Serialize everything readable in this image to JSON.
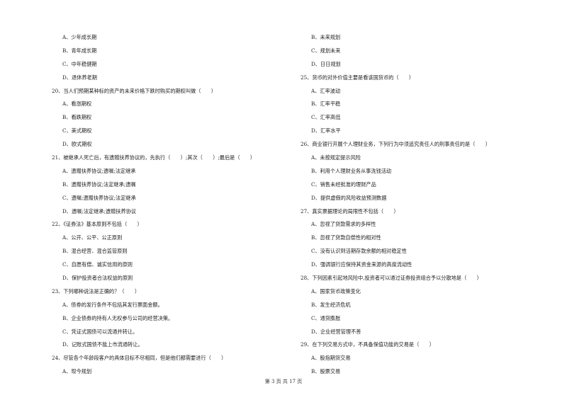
{
  "left_column": [
    {
      "type": "option",
      "text": "A、少年成长期"
    },
    {
      "type": "option",
      "text": "B、青年成长期"
    },
    {
      "type": "option",
      "text": "C、中年稳健期"
    },
    {
      "type": "option",
      "text": "D、退休养老期"
    },
    {
      "type": "question",
      "text": "20、当人们预期某种标的资产的未来价格下跌时购买的期权叫做（　　）"
    },
    {
      "type": "option",
      "text": "A、看涨期权"
    },
    {
      "type": "option",
      "text": "B、看跌期权"
    },
    {
      "type": "option",
      "text": "C、美式期权"
    },
    {
      "type": "option",
      "text": "D、欧式期权"
    },
    {
      "type": "question",
      "text": "21、被继承人死亡后，有遗赠扶养协议的，先执行（　　）;其次（　　）;最后是（　　）"
    },
    {
      "type": "option",
      "text": "A、遗赠扶养协议;遗嘱;法定继承"
    },
    {
      "type": "option",
      "text": "B、遗赠扶养协议;法定继承;遗嘱"
    },
    {
      "type": "option",
      "text": "C、遗嘱;遗赠扶养协议;法定继承"
    },
    {
      "type": "option",
      "text": "D、遗嘱;法定继承;遗赠扶养协议"
    },
    {
      "type": "question",
      "text": "22、《证券法》基本原则不包括（　　）"
    },
    {
      "type": "option",
      "text": "A、公开、公平、公正原则"
    },
    {
      "type": "option",
      "text": "B、混合经营、混合监管原则"
    },
    {
      "type": "option",
      "text": "C、自愿有偿、诚实信用的原则"
    },
    {
      "type": "option",
      "text": "D、保护投资者合法权益的原则"
    },
    {
      "type": "question",
      "text": "23、下列哪种说法是正确的？（　　）"
    },
    {
      "type": "option",
      "text": "A、债券的发行条件不包括其发行票面金额。"
    },
    {
      "type": "option",
      "text": "B、企业债券的持有人无权参与公司的经营决策。"
    },
    {
      "type": "option",
      "text": "C、凭证式国债可以流通并转让。"
    },
    {
      "type": "option",
      "text": "D、记账式国债不能上市流通转让。"
    },
    {
      "type": "question",
      "text": "24、尽管各个年龄段客户的具体目标不尽相同，但是他们都需要进行（　　）"
    },
    {
      "type": "option",
      "text": "A、现今规划"
    }
  ],
  "right_column": [
    {
      "type": "option",
      "text": "B、未来规划"
    },
    {
      "type": "option",
      "text": "C、规划未来"
    },
    {
      "type": "option",
      "text": "D、日日规划"
    },
    {
      "type": "question",
      "text": "25、货币的对外价值主要是看该国货币的（　　）"
    },
    {
      "type": "option",
      "text": "A、汇率波动"
    },
    {
      "type": "option",
      "text": "B、汇率平稳"
    },
    {
      "type": "option",
      "text": "C、汇率高低"
    },
    {
      "type": "option",
      "text": "D、汇率水平"
    },
    {
      "type": "question",
      "text": "26、商业银行开展个人理财业务，下列行为中须追究责任人的刑事责任的是（　　）"
    },
    {
      "type": "option",
      "text": "A、未按规定提示风险"
    },
    {
      "type": "option",
      "text": "B、利用个人理财业务从事洗钱活动"
    },
    {
      "type": "option",
      "text": "C、销售未经批准的理财产品"
    },
    {
      "type": "option",
      "text": "D、提供虚假的风险收益预测数据"
    },
    {
      "type": "question",
      "text": "27、真实票据理论的局限性不包括（　　）"
    },
    {
      "type": "option",
      "text": "A、忽视了贷款需求的多样性"
    },
    {
      "type": "option",
      "text": "B、忽视了贷款自偿性的相对性"
    },
    {
      "type": "option",
      "text": "C、没有认识到活期存款余额的相对稳定性"
    },
    {
      "type": "option",
      "text": "D、强调银行应保持其资金来源的高度流动性"
    },
    {
      "type": "question",
      "text": "28、下列因素引起地风险中,投资者可以通过证券投资组合予以分散地是（　　）"
    },
    {
      "type": "option",
      "text": "A、国家货币政策变化"
    },
    {
      "type": "option",
      "text": "B、发生经济危机"
    },
    {
      "type": "option",
      "text": "C、通货膨胀"
    },
    {
      "type": "option",
      "text": "D、企业经营管理不善"
    },
    {
      "type": "question",
      "text": "29、在下列交易方式中，不具备保值功能的交易是（　　）"
    },
    {
      "type": "option",
      "text": "A、股指期货交易"
    },
    {
      "type": "option",
      "text": "B、股票交易"
    }
  ],
  "footer": {
    "page_label": "第 3 页 共 17 页"
  }
}
